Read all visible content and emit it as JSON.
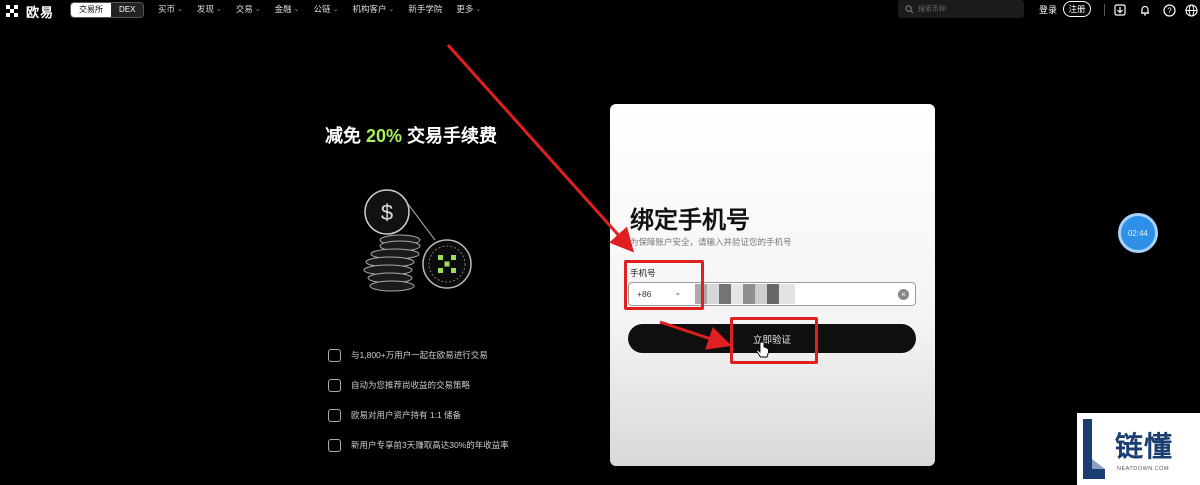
{
  "brand": {
    "name": "欧易"
  },
  "mode_tabs": [
    {
      "label": "交易所",
      "active": true
    },
    {
      "label": "DEX",
      "active": false
    }
  ],
  "nav": [
    {
      "label": "买币",
      "has_dropdown": true
    },
    {
      "label": "发现",
      "has_dropdown": true
    },
    {
      "label": "交易",
      "has_dropdown": true
    },
    {
      "label": "金融",
      "has_dropdown": true
    },
    {
      "label": "公链",
      "has_dropdown": true
    },
    {
      "label": "机构客户",
      "has_dropdown": true
    },
    {
      "label": "新手学院",
      "has_dropdown": false
    },
    {
      "label": "更多",
      "has_dropdown": true
    }
  ],
  "search": {
    "placeholder": "搜索币种"
  },
  "auth": {
    "login": "登录",
    "register": "注册"
  },
  "top_icons": [
    "download-icon",
    "bell-icon",
    "help-icon",
    "globe-icon"
  ],
  "promo": {
    "title_prefix": "减免 ",
    "title_highlight": "20%",
    "title_suffix": " 交易手续费",
    "highlight_color": "#a8f05a",
    "features": [
      {
        "icon": "users-icon",
        "text": "与1,800+万用户一起在欧易进行交易"
      },
      {
        "icon": "robot-icon",
        "text": "自动为您推荐尚收益的交易策略"
      },
      {
        "icon": "wallet-icon",
        "text": "欧易对用户资产持有 1:1 储备"
      },
      {
        "icon": "chart-icon",
        "text": "新用户专享前3天赚取高达30%的年收益率"
      }
    ]
  },
  "bind_phone": {
    "title": "绑定手机号",
    "subtitle": "为保障账户安全，请输入并验证您的手机号",
    "phone_label": "手机号",
    "country_code": "+86",
    "phone_value": "",
    "verify_button": "立即验证"
  },
  "timer": {
    "text": "02:44",
    "color": "#2e8fe8"
  },
  "watermark": {
    "name": "链懂",
    "url": "NEATDOWN.COM"
  },
  "annotation_color": "#e02020"
}
